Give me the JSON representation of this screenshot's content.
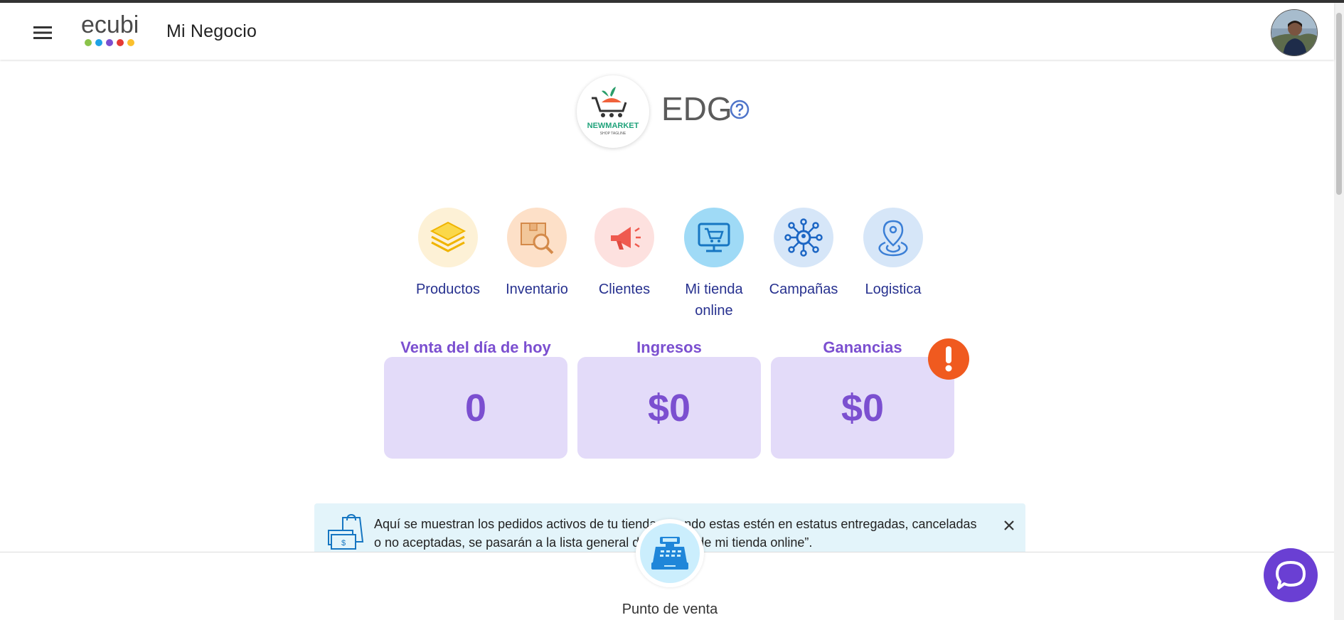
{
  "header": {
    "menu_icon": "hamburger-menu-icon",
    "logo_text": "ecubi",
    "title": "Mi Negocio",
    "avatar_icon": "user-avatar"
  },
  "store": {
    "logo_text": "NEWMARKET",
    "logo_subtext": "SHOP TAGLINE",
    "name": "EDG",
    "help_icon": "help-circle-icon"
  },
  "nav": {
    "items": [
      {
        "label": "Productos",
        "icon": "layers-icon",
        "color": "#fdf1d6"
      },
      {
        "label": "Inventario",
        "icon": "inventory-search-icon",
        "color": "#fde0c8"
      },
      {
        "label": "Clientes",
        "icon": "megaphone-icon",
        "color": "#fde1df"
      },
      {
        "label": "Mi tienda online",
        "icon": "online-store-icon",
        "color": "#9fdaf6"
      },
      {
        "label": "Campañas",
        "icon": "network-icon",
        "color": "#d6e6f8"
      },
      {
        "label": "Logistica",
        "icon": "location-pin-icon",
        "color": "#d6e6f8"
      }
    ]
  },
  "kpis": [
    {
      "title": "Venta del día de hoy",
      "value": "0"
    },
    {
      "title": "Ingresos",
      "value": "$0"
    },
    {
      "title": "Ganancias",
      "value": "$0"
    }
  ],
  "alert": {
    "icon": "exclamation-icon",
    "color": "#f05a1f"
  },
  "banner": {
    "text": "Aquí se muestran los pedidos activos de tu tienda, cuando estas estén en estatus entregadas, canceladas o no aceptadas, se pasarán a la lista general de “Ventas de mi tienda online”.",
    "close_icon": "close-icon"
  },
  "pos": {
    "label": "Punto de venta",
    "icon": "cash-register-icon"
  },
  "chat": {
    "icon": "chat-bubble-icon"
  },
  "colors": {
    "accent": "#7b4fd0",
    "card_bg": "#e3dbf9",
    "nav_text": "#27318f",
    "chat": "#6a3fd3"
  }
}
